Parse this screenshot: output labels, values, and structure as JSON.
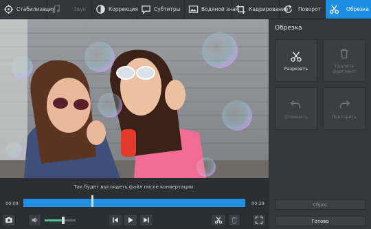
{
  "toolbar": {
    "tabs": [
      {
        "label": "Стабилизация",
        "icon": "stabilization-icon"
      },
      {
        "label": "Звук",
        "icon": "music-note-icon",
        "disabled": true
      },
      {
        "label": "Коррекция",
        "icon": "contrast-icon"
      },
      {
        "label": "Субтитры",
        "icon": "speech-bubble-icon"
      },
      {
        "label": "Водяной знак",
        "icon": "watermark-icon"
      },
      {
        "label": "Кадрирование",
        "icon": "crop-icon"
      },
      {
        "label": "Поворот",
        "icon": "rotate-icon"
      },
      {
        "label": "Обрезка",
        "icon": "scissors-icon",
        "active": true
      }
    ]
  },
  "panel": {
    "title": "Обрезка",
    "cut_label": "Разрезать",
    "delete_label": "Удалить фрагмент",
    "undo_label": "Отменить",
    "redo_label": "Повторить",
    "reset_label": "Сброс",
    "done_label": "Готово"
  },
  "preview": {
    "hint": "Так будет выглядеть файл после конвертации."
  },
  "timeline": {
    "start_time": "00:09",
    "end_time": "00:29",
    "playhead_fraction": 0.31
  },
  "volume": {
    "level_fraction": 0.6
  },
  "colors": {
    "accent": "#1e8ee3",
    "volume": "#46c98a"
  }
}
